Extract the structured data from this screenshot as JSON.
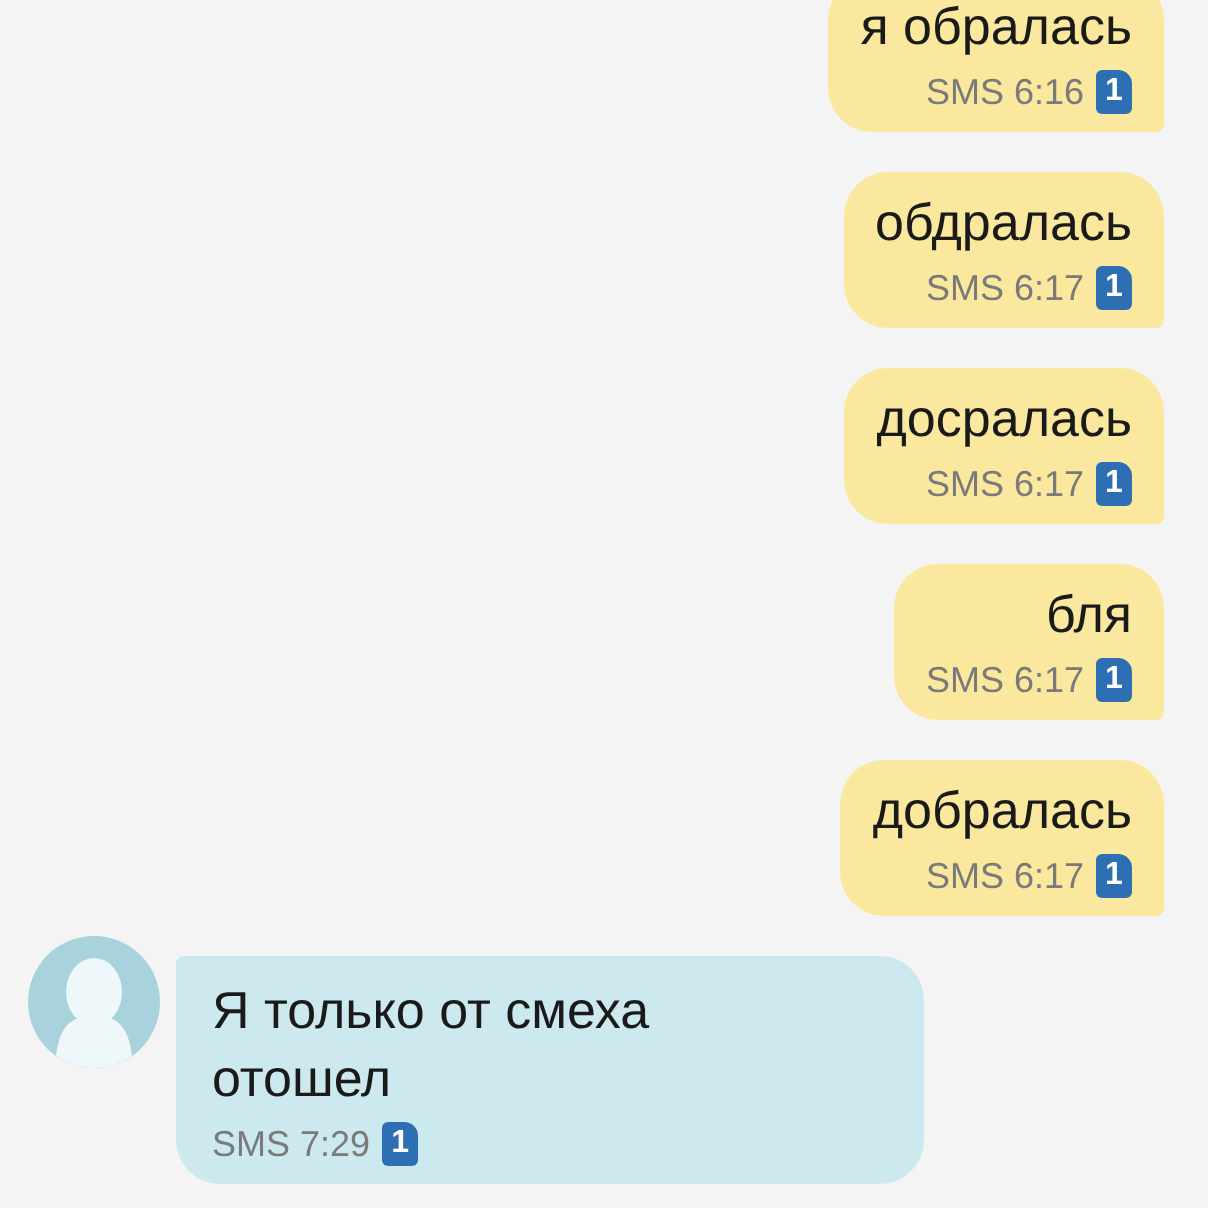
{
  "messages": [
    {
      "kind": "sent",
      "text": "я обралась",
      "service": "SMS",
      "time": "6:16",
      "sim": "1"
    },
    {
      "kind": "sent",
      "text": "обдралась",
      "service": "SMS",
      "time": "6:17",
      "sim": "1"
    },
    {
      "kind": "sent",
      "text": "досралась",
      "service": "SMS",
      "time": "6:17",
      "sim": "1"
    },
    {
      "kind": "sent",
      "text": "бля",
      "service": "SMS",
      "time": "6:17",
      "sim": "1"
    },
    {
      "kind": "sent",
      "text": "добралась",
      "service": "SMS",
      "time": "6:17",
      "sim": "1"
    },
    {
      "kind": "received",
      "text": "Я только от смеха отошел",
      "service": "SMS",
      "time": "7:29",
      "sim": "1"
    }
  ]
}
